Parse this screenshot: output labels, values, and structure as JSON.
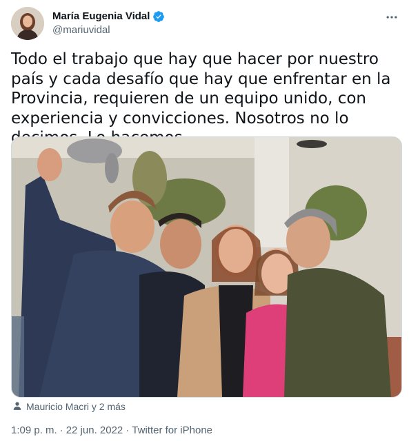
{
  "author": {
    "display_name": "María Eugenia Vidal",
    "handle": "@mariuvidal",
    "verified_icon": "verified-badge-icon",
    "accent_color": "#1d9bf0"
  },
  "menu": {
    "more_icon": "more-horizontal-icon"
  },
  "tweet": {
    "text": "Todo el trabajo que hay que hacer por nuestro país y cada desafío que hay que enfrentar en la Provincia, requieren de un equipo unido, con experiencia y convicciones. Nosotros no lo decimos. Lo hacemos."
  },
  "media": {
    "tagged_icon": "person-icon",
    "tagged_text": "Mauricio Macri y 2 más"
  },
  "meta": {
    "time": "1:09 p. m.",
    "separator1": "·",
    "date": "22 jun. 2022",
    "separator2": "·",
    "source": "Twitter for iPhone"
  }
}
